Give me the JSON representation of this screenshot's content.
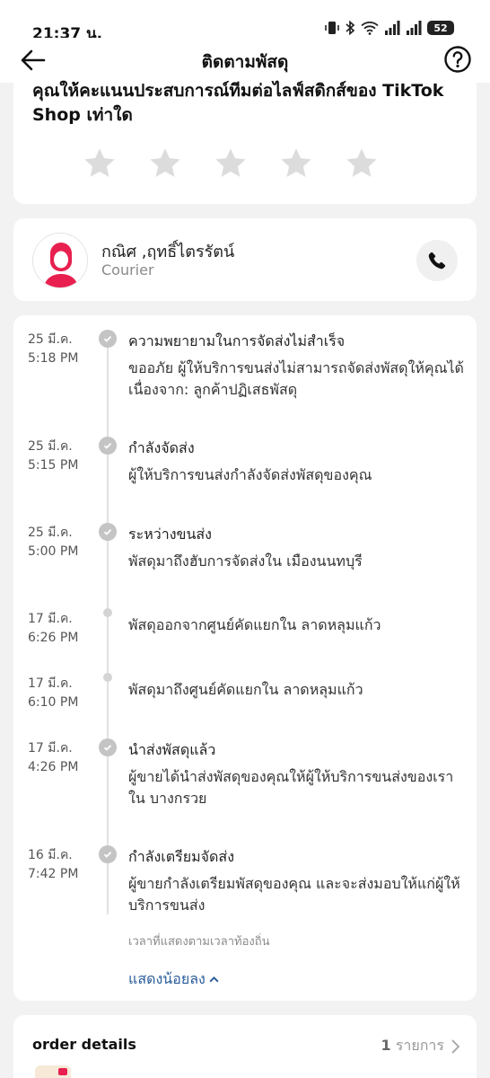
{
  "status_bar": {
    "time": "21:37 น.",
    "battery": "52"
  },
  "nav": {
    "title": "ติดตามพัสดุ"
  },
  "rating": {
    "prompt": "คุณให้คะแนนประสบการณ์ทีมต่อไลฟ์สดิกส์ของ TikTok Shop เท่าใด",
    "star_count": 5
  },
  "courier": {
    "name": "กณิศ ,ฤทธิ์ไตรรัตน์",
    "role": "Courier"
  },
  "timeline": {
    "events": [
      {
        "date": "25 มี.ค.",
        "time": "5:18 PM",
        "title": "ความพยายามในการจัดส่งไม่สำเร็จ",
        "desc": "ขออภัย ผู้ให้บริการขนส่งไม่สามารถจัดส่งพัสดุให้คุณได้เนื่องจาก: ลูกค้าปฏิเสธพัสดุ"
      },
      {
        "date": "25 มี.ค.",
        "time": "5:15 PM",
        "title": "กำลังจัดส่ง",
        "desc": "ผู้ให้บริการขนส่งกำลังจัดส่งพัสดุของคุณ"
      },
      {
        "date": "25 มี.ค.",
        "time": "5:00 PM",
        "title": "ระหว่างขนส่ง",
        "desc": "พัสดุมาถึงฮับการจัดส่งใน เมืองนนทบุรี"
      },
      {
        "date": "17 มี.ค.",
        "time": "6:26 PM",
        "title": "",
        "desc": "พัสดุออกจากศูนย์คัดแยกใน ลาดหลุมแก้ว"
      },
      {
        "date": "17 มี.ค.",
        "time": "6:10 PM",
        "title": "",
        "desc": "พัสดุมาถึงศูนย์คัดแยกใน ลาดหลุมแก้ว"
      },
      {
        "date": "17 มี.ค.",
        "time": "4:26 PM",
        "title": "นำส่งพัสดุแล้ว",
        "desc": "ผู้ขายได้นำส่งพัสดุของคุณให้ผู้ให้บริการขนส่งของเราใน บางกรวย"
      },
      {
        "date": "16 มี.ค.",
        "time": "7:42 PM",
        "title": "กำลังเตรียมจัดส่ง",
        "desc": "ผู้ขายกำลังเตรียมพัสดุของคุณ และจะส่งมอบให้แก่ผู้ให้บริการขนส่ง"
      }
    ],
    "note": "เวลาที่แสดงตามเวลาท้องถิ่น",
    "show_less": "แสดงน้อยลง"
  },
  "order": {
    "title": "order details",
    "count": "1",
    "count_unit": "รายการ"
  },
  "colors": {
    "link": "#2a5c9a",
    "avatar": "#e8204f",
    "dot": "#c4c4c4"
  }
}
